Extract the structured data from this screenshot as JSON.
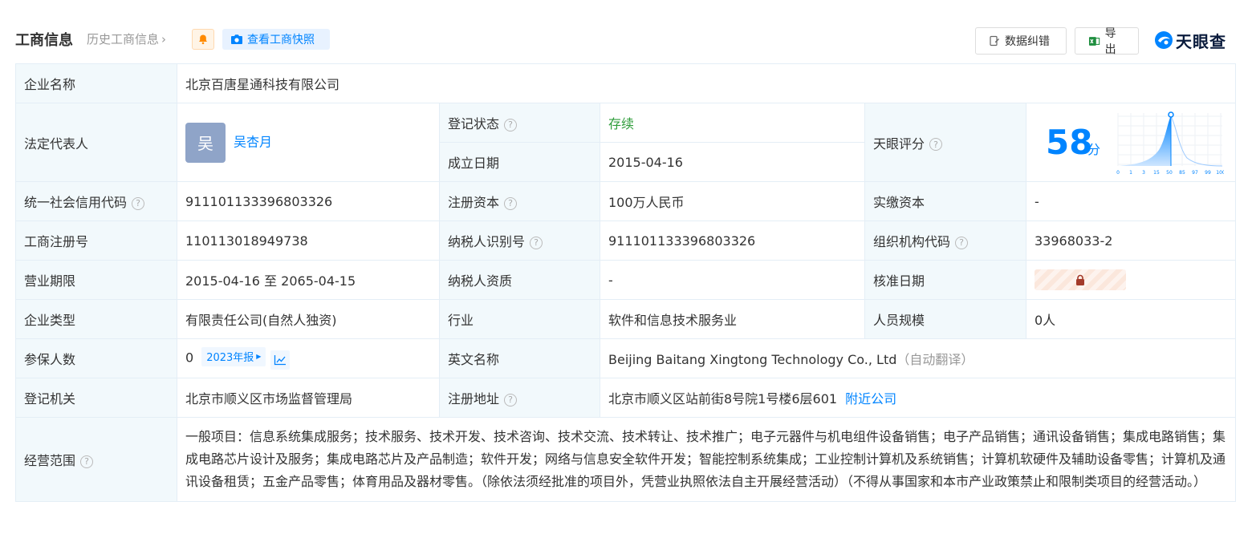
{
  "header": {
    "title": "工商信息",
    "history": "历史工商信息",
    "snapshot_label": "查看工商快照",
    "correct_label": "数据纠错",
    "export_label": "导出",
    "logo_text": "天眼查"
  },
  "rows": {
    "company_name": {
      "label": "企业名称",
      "value": "北京百唐星通科技有限公司"
    },
    "legal_rep": {
      "label": "法定代表人",
      "avatar": "吴",
      "value": "吴杏月"
    },
    "reg_status": {
      "label": "登记状态",
      "value": "存续"
    },
    "founded": {
      "label": "成立日期",
      "value": "2015-04-16"
    },
    "tianyan_score": {
      "label": "天眼评分",
      "value": "58",
      "unit": "分",
      "axis_ticks": [
        "0",
        "1",
        "3",
        "15",
        "50",
        "85",
        "97",
        "99",
        "100"
      ]
    },
    "credit_code": {
      "label": "统一社会信用代码",
      "value": "911101133396803326"
    },
    "reg_capital": {
      "label": "注册资本",
      "value": "100万人民币"
    },
    "paid_capital": {
      "label": "实缴资本",
      "value": "-"
    },
    "reg_number": {
      "label": "工商注册号",
      "value": "110113018949738"
    },
    "taxpayer_id": {
      "label": "纳税人识别号",
      "value": "911101133396803326"
    },
    "org_code": {
      "label": "组织机构代码",
      "value": "33968033-2"
    },
    "term": {
      "label": "营业期限",
      "value": "2015-04-16 至 2065-04-15"
    },
    "tax_qual": {
      "label": "纳税人资质",
      "value": "-"
    },
    "approve_date": {
      "label": "核准日期"
    },
    "company_type": {
      "label": "企业类型",
      "value": "有限责任公司(自然人独资)"
    },
    "industry": {
      "label": "行业",
      "value": "软件和信息技术服务业"
    },
    "staff_size": {
      "label": "人员规模",
      "value": "0人"
    },
    "insured": {
      "label": "参保人数",
      "value": "0",
      "year_tag": "2023年报"
    },
    "english_name": {
      "label": "英文名称",
      "value": "Beijing Baitang Xingtong Technology Co., Ltd",
      "note": "（自动翻译）"
    },
    "reg_authority": {
      "label": "登记机关",
      "value": "北京市顺义区市场监督管理局"
    },
    "reg_address": {
      "label": "注册地址",
      "value": "北京市顺义区站前街8号院1号楼6层601",
      "nearby": "附近公司"
    },
    "scope": {
      "label": "经营范围",
      "value": "一般项目：信息系统集成服务；技术服务、技术开发、技术咨询、技术交流、技术转让、技术推广；电子元器件与机电组件设备销售；电子产品销售；通讯设备销售；集成电路销售；集成电路芯片设计及服务；集成电路芯片及产品制造；软件开发；网络与信息安全软件开发；智能控制系统集成；工业控制计算机及系统销售；计算机软硬件及辅助设备零售；计算机及通讯设备租赁；五金产品零售；体育用品及器材零售。（除依法须经批准的项目外，凭营业执照依法自主开展经营活动）（不得从事国家和本市产业政策禁止和限制类项目的经营活动。）"
    }
  },
  "colors": {
    "accent": "#0084ff",
    "status_green": "#2e9d3a",
    "label_bg": "#f2f9fc",
    "border": "#e4eef6"
  }
}
